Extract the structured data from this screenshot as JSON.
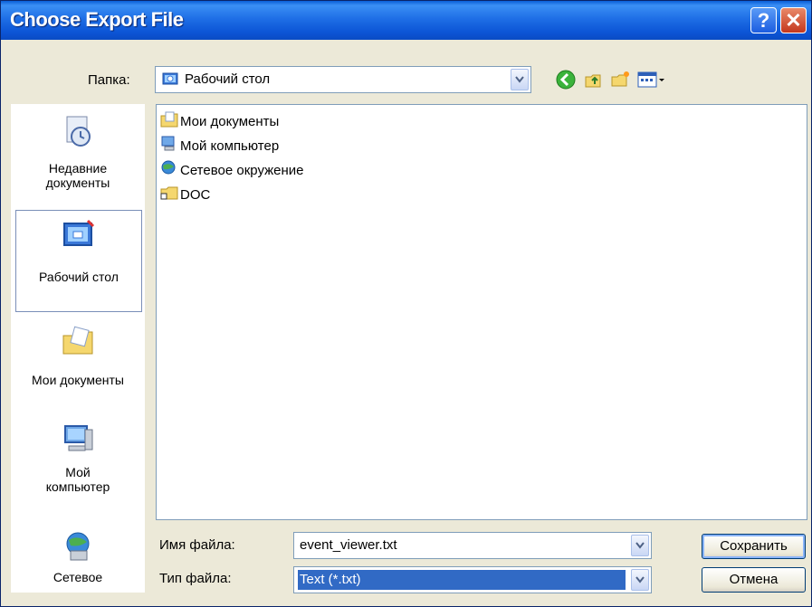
{
  "window": {
    "title": "Choose Export File"
  },
  "titlebar": {
    "help": "?",
    "close": "✕"
  },
  "lookin": {
    "label": "Папка:",
    "value": "Рабочий стол"
  },
  "places": [
    {
      "label_line1": "Недавние",
      "label_line2": "документы"
    },
    {
      "label_line1": "Рабочий стол",
      "label_line2": ""
    },
    {
      "label_line1": "Мои документы",
      "label_line2": ""
    },
    {
      "label_line1": "Мой",
      "label_line2": "компьютер"
    },
    {
      "label_line1": "Сетевое",
      "label_line2": ""
    }
  ],
  "files": [
    {
      "name": "Мои документы",
      "icon": "my-documents-icon"
    },
    {
      "name": "Мой компьютер",
      "icon": "my-computer-icon"
    },
    {
      "name": "Сетевое окружение",
      "icon": "network-icon"
    },
    {
      "name": "DOC",
      "icon": "folder-icon"
    }
  ],
  "filename": {
    "label": "Имя файла:",
    "value": "event_viewer.txt"
  },
  "filetype": {
    "label": "Тип файла:",
    "value": "Text (*.txt)"
  },
  "buttons": {
    "save": "Сохранить",
    "cancel": "Отмена"
  }
}
